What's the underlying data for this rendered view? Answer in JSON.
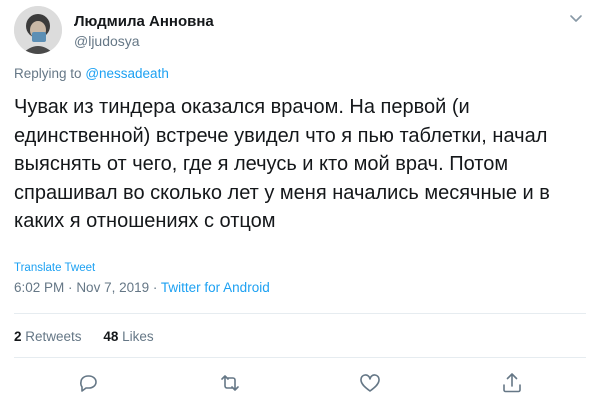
{
  "author": {
    "name": "Людмила Анновна",
    "handle": "@ljudosya"
  },
  "reply": {
    "prefix": "Replying to",
    "mention": "@nessadeath"
  },
  "tweet": {
    "text": "Чувак из тиндера оказался врачом. На первой (и единственной) встрече увидел что я пью таблетки, начал выяснять от чего, где я лечусь и кто мой врач. Потом спрашивал во сколько лет у меня начались месячные и в каких я отношениях с отцом",
    "translate_label": "Translate Tweet",
    "time": "6:02 PM",
    "date": "Nov 7, 2019",
    "separator": "·",
    "source": "Twitter for Android"
  },
  "stats": {
    "retweets_count": "2",
    "retweets_label": "Retweets",
    "likes_count": "48",
    "likes_label": "Likes"
  },
  "icons": {
    "menu": "chevron-down-icon",
    "reply": "reply-icon",
    "retweet": "retweet-icon",
    "like": "heart-icon",
    "share": "share-icon"
  },
  "colors": {
    "accent": "#1da1f2",
    "secondary_text": "#657786",
    "primary_text": "#14171a",
    "divider": "#e6ecf0"
  }
}
